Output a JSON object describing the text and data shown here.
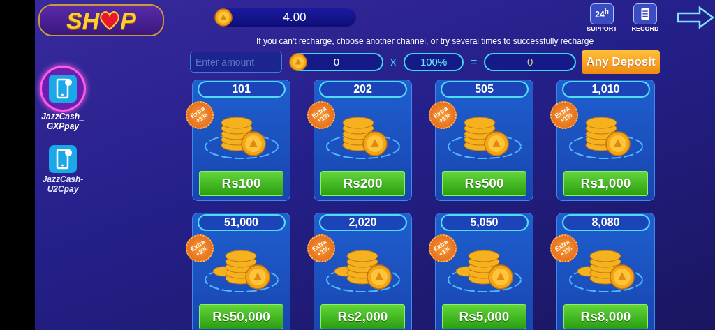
{
  "logo": {
    "text_before": "SH",
    "text_after": "P"
  },
  "balance": "4.00",
  "header_actions": [
    {
      "kind": "support",
      "badge": "24",
      "badge_sup": "h",
      "label": "SUPPORT"
    },
    {
      "kind": "record",
      "label": "RECORD"
    }
  ],
  "notice": "If you can't recharge, choose another channel, or try several times to successfully recharge",
  "calculator": {
    "amount_placeholder": "Enter amount",
    "coins": "0",
    "multiply": "x",
    "bonus": "100%",
    "equals": "=",
    "total": "0",
    "button": "Any Deposit"
  },
  "channels": [
    {
      "label_lines": [
        "JazzCash_",
        "GXPpay"
      ],
      "selected": true
    },
    {
      "label_lines": [
        "JazzCash-",
        "U2Cpay"
      ],
      "selected": false
    }
  ],
  "packages": [
    {
      "coins": "101",
      "badge_lines": [
        "Extra",
        "+1%"
      ],
      "price": "Rs100",
      "kind": "stack"
    },
    {
      "coins": "202",
      "badge_lines": [
        "Extra",
        "+1%"
      ],
      "price": "Rs200",
      "kind": "stack"
    },
    {
      "coins": "505",
      "badge_lines": [
        "Extra",
        "+1%"
      ],
      "price": "Rs500",
      "kind": "stack"
    },
    {
      "coins": "1,010",
      "badge_lines": [
        "Extra",
        "+1%"
      ],
      "price": "Rs1,000",
      "kind": "stack"
    },
    {
      "coins": "51,000",
      "badge_lines": [
        "Extra",
        "+2%"
      ],
      "price": "Rs50,000",
      "kind": "pile"
    },
    {
      "coins": "2,020",
      "badge_lines": [
        "Extra",
        "+1%"
      ],
      "price": "Rs2,000",
      "kind": "pile"
    },
    {
      "coins": "5,050",
      "badge_lines": [
        "Extra",
        "+1%"
      ],
      "price": "Rs5,000",
      "kind": "pile"
    },
    {
      "coins": "8,080",
      "badge_lines": [
        "Extra",
        "+1%"
      ],
      "price": "Rs8,000",
      "kind": "pile"
    }
  ]
}
